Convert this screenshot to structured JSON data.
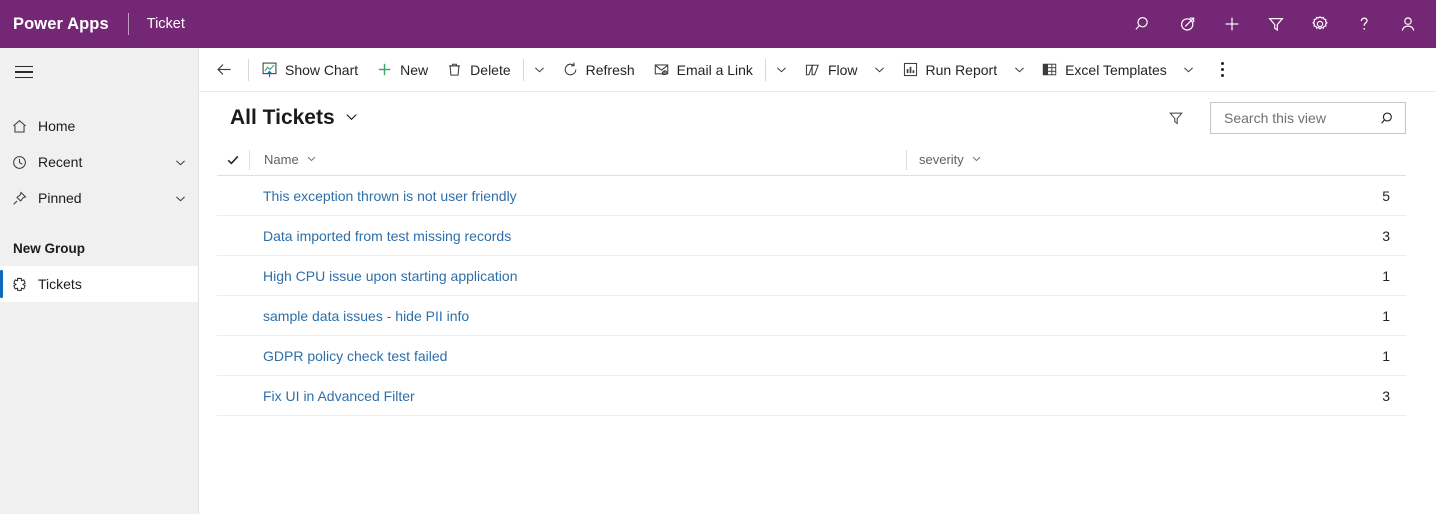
{
  "header": {
    "brand": "Power Apps",
    "app_name": "Ticket",
    "background_color": "#742774",
    "icons": [
      {
        "name": "search-icon",
        "label": "Search"
      },
      {
        "name": "diagnostics-icon",
        "label": "Quick launch"
      },
      {
        "name": "plus-icon",
        "label": "New"
      },
      {
        "name": "filter-icon",
        "label": "Filter"
      },
      {
        "name": "gear-icon",
        "label": "Settings"
      },
      {
        "name": "help-icon",
        "label": "Help"
      },
      {
        "name": "user-avatar-icon",
        "label": "Account manager"
      }
    ]
  },
  "sidebar": {
    "background_color": "#f0f0f0",
    "accent_color": "#0f6cbd",
    "hamburger_label": "Site map",
    "items": [
      {
        "label": "Home",
        "icon": "home-icon",
        "chevron": false,
        "selected": false
      },
      {
        "label": "Recent",
        "icon": "clock-icon",
        "chevron": true,
        "selected": false
      },
      {
        "label": "Pinned",
        "icon": "pin-icon",
        "chevron": true,
        "selected": false
      }
    ],
    "group_title": "New Group",
    "group_items": [
      {
        "label": "Tickets",
        "icon": "entity-icon",
        "chevron": false,
        "selected": true
      }
    ]
  },
  "command_bar": {
    "back_label": "Back",
    "buttons": [
      {
        "label": "Show Chart",
        "icon": "show-chart-icon",
        "chevron": false
      },
      {
        "label": "New",
        "icon": "plus-green-icon",
        "chevron": false
      },
      {
        "label": "Delete",
        "icon": "trash-icon",
        "chevron": false,
        "separator_after": true,
        "standalone_chevron": true
      },
      {
        "label": "Refresh",
        "icon": "refresh-icon",
        "chevron": false
      },
      {
        "label": "Email a Link",
        "icon": "email-link-icon",
        "chevron": false,
        "separator_after": true,
        "standalone_chevron": true
      },
      {
        "label": "Flow",
        "icon": "flow-icon",
        "chevron": true
      },
      {
        "label": "Run Report",
        "icon": "run-report-icon",
        "chevron": true
      },
      {
        "label": "Excel Templates",
        "icon": "excel-templates-icon",
        "chevron": true
      }
    ],
    "overflow_label": "More commands"
  },
  "view": {
    "title": "All Tickets",
    "selector_icon": "chevron-down-icon",
    "filter_icon": "filter-icon",
    "search": {
      "placeholder": "Search this view",
      "value": "",
      "icon": "search-icon"
    }
  },
  "grid": {
    "select_all_icon": "checkmark-icon",
    "columns": [
      {
        "key": "name",
        "label": "Name",
        "align": "left"
      },
      {
        "key": "severity",
        "label": "severity",
        "align": "right"
      }
    ],
    "rows": [
      {
        "name": "This exception thrown is not user friendly",
        "severity": "5"
      },
      {
        "name": "Data imported from test missing records",
        "severity": "3"
      },
      {
        "name": "High CPU issue upon starting application",
        "severity": "1"
      },
      {
        "name": "sample data issues - hide PII info",
        "severity": "1"
      },
      {
        "name": "GDPR policy check test failed",
        "severity": "1"
      },
      {
        "name": "Fix UI in Advanced Filter",
        "severity": "3"
      }
    ],
    "link_color": "#2e6fa8"
  }
}
